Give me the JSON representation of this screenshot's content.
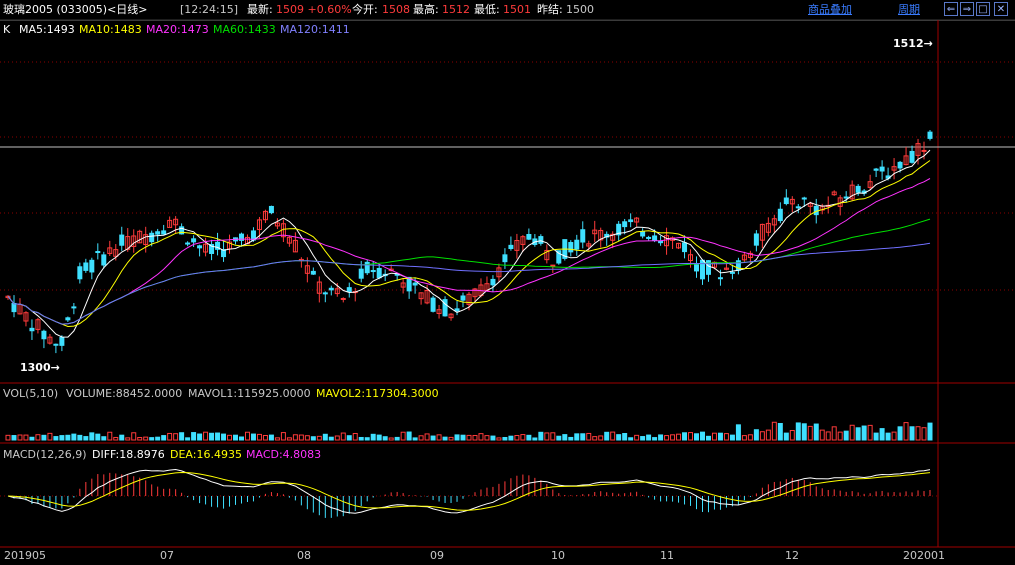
{
  "header": {
    "title": "玻璃2005 (033005)<日线>",
    "time": "[12:24:15]",
    "latest_label": "最新:",
    "latest_value": "1509 +0.60%",
    "open_label": "今开:",
    "open_value": "1508",
    "high_label": "最高:",
    "high_value": "1512",
    "low_label": "最低:",
    "low_value": "1501",
    "prev_close_label": "昨结:",
    "prev_close_value": "1500",
    "overlay_link": "商品叠加",
    "period_link": "周期"
  },
  "window_buttons": [
    "⇐",
    "⇒",
    "□",
    "✕"
  ],
  "main_legend": {
    "k": "K",
    "ma5": "MA5:1493",
    "ma10": "MA10:1483",
    "ma20": "MA20:1473",
    "ma60": "MA60:1433",
    "ma120": "MA120:1411"
  },
  "annotations": {
    "high": "1512",
    "low": "1300"
  },
  "vol_legend": {
    "name": "VOL(5,10)",
    "volume": "VOLUME:88452.0000",
    "mavol1": "MAVOL1:115925.0000",
    "mavol2": "MAVOL2:117304.3000"
  },
  "macd_legend": {
    "name": "MACD(12,26,9)",
    "diff": "DIFF:18.8976",
    "dea": "DEA:16.4935",
    "macd": "MACD:4.8083"
  },
  "x_axis": {
    "labels": [
      "201905",
      "07",
      "08",
      "09",
      "10",
      "11",
      "12",
      "202001"
    ]
  },
  "colors": {
    "up": "#ff3b3b",
    "down": "#3fe0ff",
    "ma5": "#ffffff",
    "ma10": "#ffff00",
    "ma20": "#ff33ff",
    "ma60": "#00e000",
    "ma120": "#7070ff",
    "grid": "#8b0000",
    "border": "#a00000"
  }
}
